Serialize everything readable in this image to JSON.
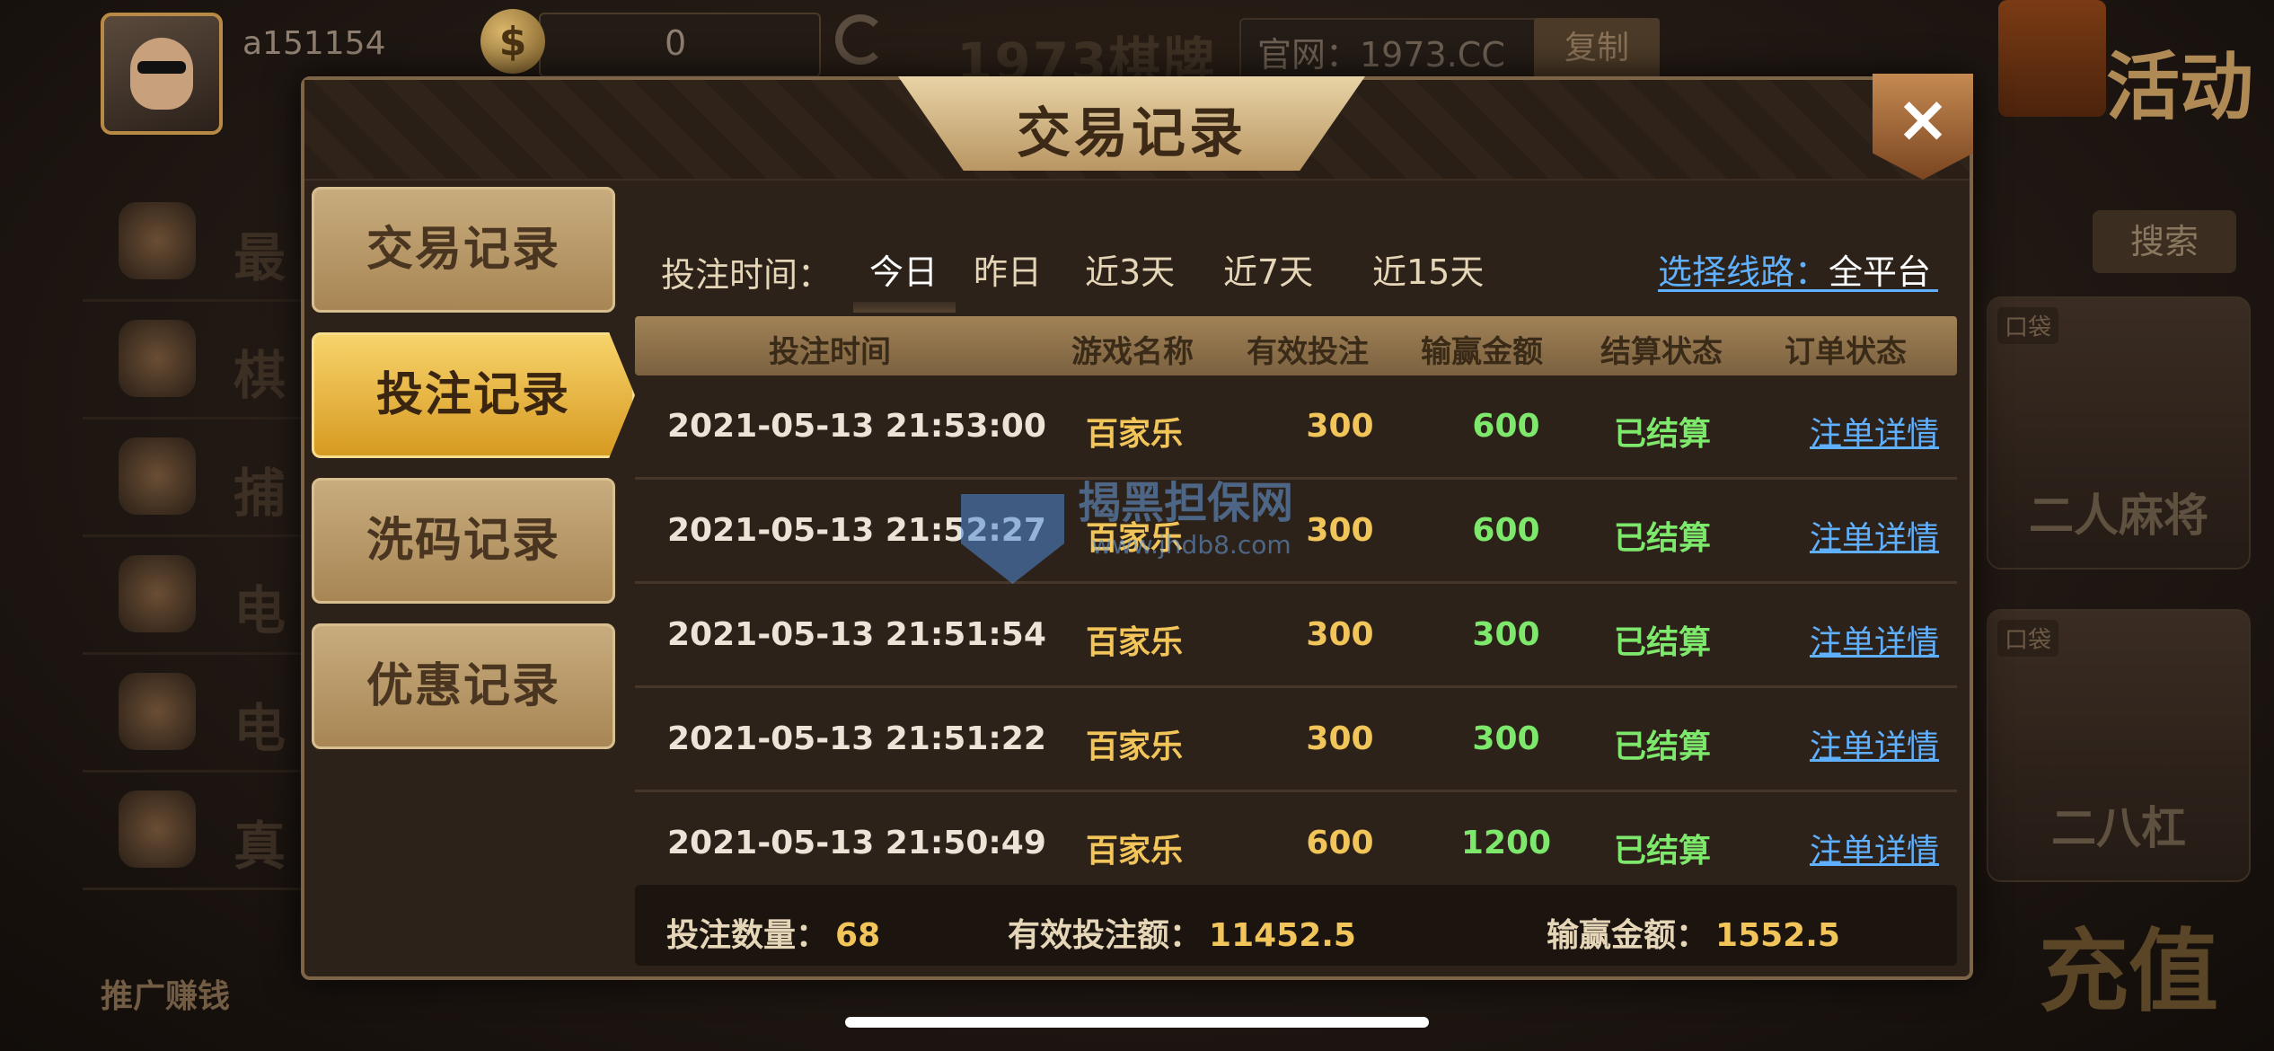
{
  "background": {
    "user_id": "a151154",
    "coin_balance": "0",
    "brand": "1973棋牌",
    "site_label": "官网：1973.CC",
    "copy_button": "复制",
    "activity": "活动",
    "search_button": "搜索",
    "menu_chars": [
      "最",
      "棋",
      "捕",
      "电",
      "电",
      "真"
    ],
    "promo": "推广赚钱",
    "game_cards": [
      {
        "tag": "口袋",
        "name": "二人麻将"
      },
      {
        "tag": "口袋",
        "name": "二八杠"
      }
    ],
    "recharge": "充值"
  },
  "dialog": {
    "title": "交易记录",
    "close_label": "×",
    "side_tabs": [
      "交易记录",
      "投注记录",
      "洗码记录",
      "优惠记录"
    ],
    "active_tab": "投注记录",
    "time_label": "投注时间：",
    "time_filters": [
      "今日",
      "昨日",
      "近3天",
      "近7天",
      "近15天"
    ],
    "active_filter": "今日",
    "route_label": "选择线路：",
    "route_value": "全平台",
    "table": {
      "headers": [
        "投注时间",
        "游戏名称",
        "有效投注",
        "输赢金额",
        "结算状态",
        "订单状态"
      ],
      "rows": [
        {
          "time": "2021-05-13 21:53:00",
          "game": "百家乐",
          "bet": "300",
          "win": "600",
          "status": "已结算",
          "detail": "注单详情"
        },
        {
          "time": "2021-05-13 21:52:27",
          "game": "百家乐",
          "bet": "300",
          "win": "600",
          "status": "已结算",
          "detail": "注单详情"
        },
        {
          "time": "2021-05-13 21:51:54",
          "game": "百家乐",
          "bet": "300",
          "win": "300",
          "status": "已结算",
          "detail": "注单详情"
        },
        {
          "time": "2021-05-13 21:51:22",
          "game": "百家乐",
          "bet": "300",
          "win": "300",
          "status": "已结算",
          "detail": "注单详情"
        },
        {
          "time": "2021-05-13 21:50:49",
          "game": "百家乐",
          "bet": "600",
          "win": "1200",
          "status": "已结算",
          "detail": "注单详情"
        }
      ]
    },
    "summary": {
      "count_label": "投注数量：",
      "count_value": "68",
      "valid_label": "有效投注额：",
      "valid_value": "11452.5",
      "win_label": "输赢金额：",
      "win_value": "1552.5"
    }
  },
  "watermark": {
    "title": "揭黑担保网",
    "url": "www.jhdb8.com"
  },
  "colors": {
    "accent_gold": "#f1c55a",
    "win_green": "#7de86b",
    "link_blue": "#5fb0ff"
  }
}
